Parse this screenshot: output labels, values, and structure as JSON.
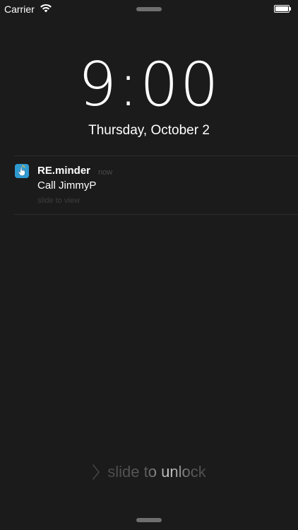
{
  "status_bar": {
    "carrier": "Carrier",
    "wifi_icon": "wifi-icon",
    "battery_icon": "battery-icon",
    "battery_level": 1.0
  },
  "lock_screen": {
    "time": "9:00",
    "date": "Thursday, October 2"
  },
  "notification": {
    "app_icon": "reminder-app-icon",
    "app_name": "RE.minder",
    "time": "now",
    "message": "Call JimmyP",
    "action": "slide to view"
  },
  "unlock": {
    "chevron_icon": "chevron-right-icon",
    "label": "slide to unlock"
  },
  "colors": {
    "background": "#1b1b1b",
    "text": "#ffffff",
    "muted": "#4b4b4b",
    "app_icon_bg": "#2f9ad0"
  }
}
